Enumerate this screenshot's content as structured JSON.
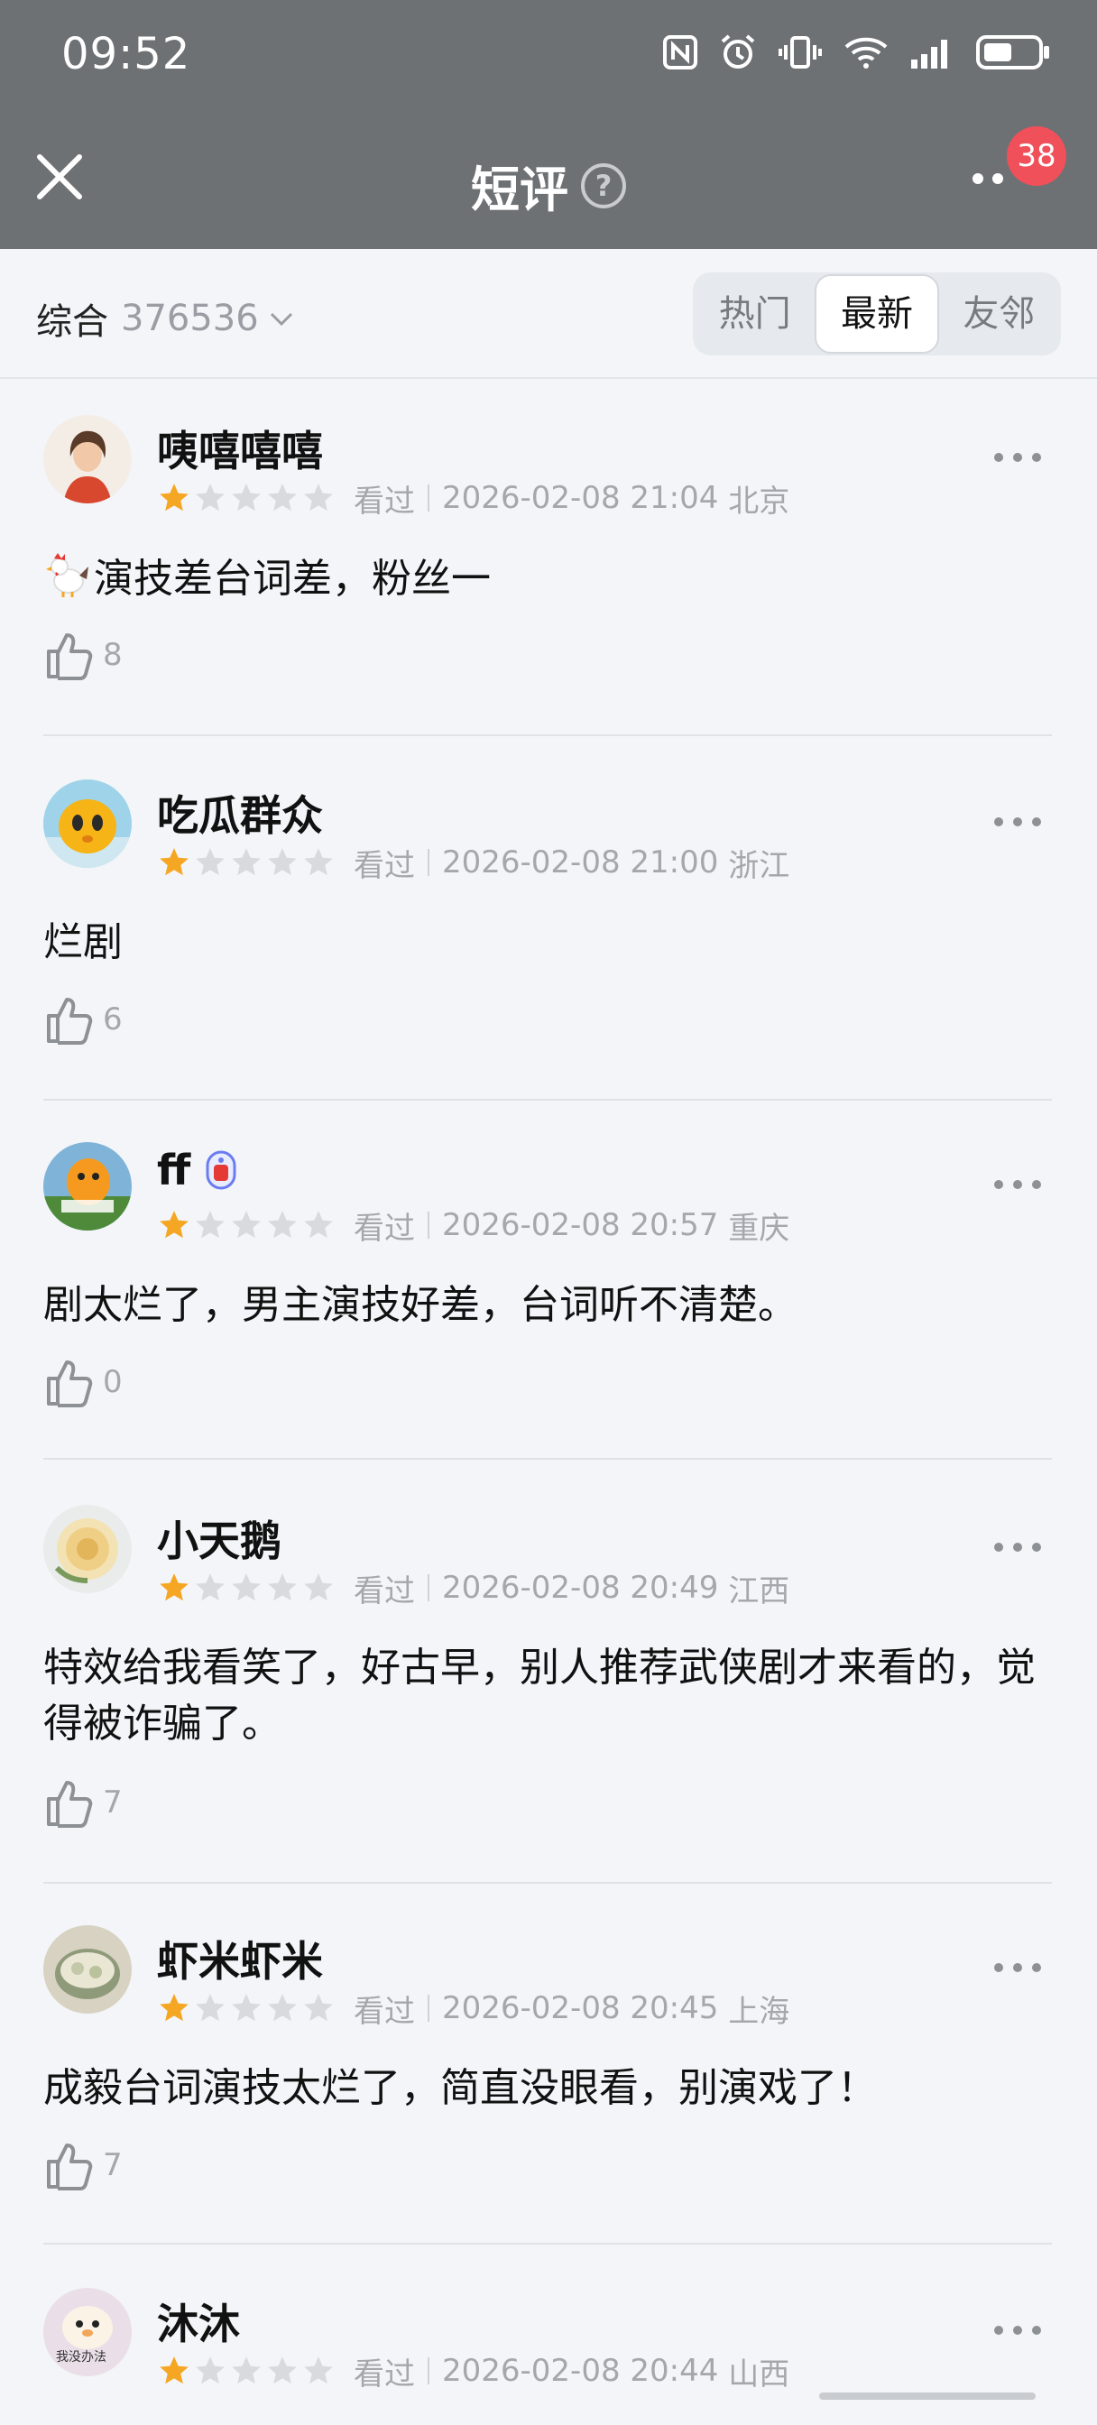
{
  "status_bar": {
    "time": "09:52"
  },
  "header": {
    "title": "短评",
    "help_icon": "question-circle-icon",
    "badge_count": "38"
  },
  "filter": {
    "sort_label": "综合",
    "count": "376536",
    "tabs": [
      {
        "label": "热门",
        "active": false
      },
      {
        "label": "最新",
        "active": true
      },
      {
        "label": "友邻",
        "active": false
      }
    ]
  },
  "colors": {
    "star_on": "#f5a623",
    "star_off": "#d8dadd",
    "header_bg": "#6e7174",
    "badge": "#f0505a"
  },
  "reviews": [
    {
      "username": "咦嘻嘻嘻",
      "rating": 1,
      "status": "看过",
      "datetime": "2026-02-08 21:04",
      "location": "北京",
      "emoji": "rooster",
      "content": "演技差台词差，粉丝一",
      "likes": "8"
    },
    {
      "username": "吃瓜群众",
      "rating": 1,
      "status": "看过",
      "datetime": "2026-02-08 21:00",
      "location": "浙江",
      "content": "烂剧",
      "likes": "6"
    },
    {
      "username": "ff",
      "rating": 1,
      "status": "看过",
      "datetime": "2026-02-08 20:57",
      "location": "重庆",
      "content": "剧太烂了，男主演技好差，台词听不清楚。",
      "likes": "0"
    },
    {
      "username": "小天鹅",
      "rating": 1,
      "status": "看过",
      "datetime": "2026-02-08 20:49",
      "location": "江西",
      "content": "特效给我看笑了，好古早，别人推荐武侠剧才来看的，觉得被诈骗了。",
      "likes": "7"
    },
    {
      "username": "虾米虾米",
      "rating": 1,
      "status": "看过",
      "datetime": "2026-02-08 20:45",
      "location": "上海",
      "content": "成毅台词演技太烂了，简直没眼看，别演戏了！",
      "likes": "7"
    },
    {
      "username": "沐沐",
      "rating": 1,
      "status": "看过",
      "datetime": "2026-02-08 20:44",
      "location": "山西",
      "avatar_text": "我没办法",
      "content": "",
      "likes": ""
    }
  ]
}
